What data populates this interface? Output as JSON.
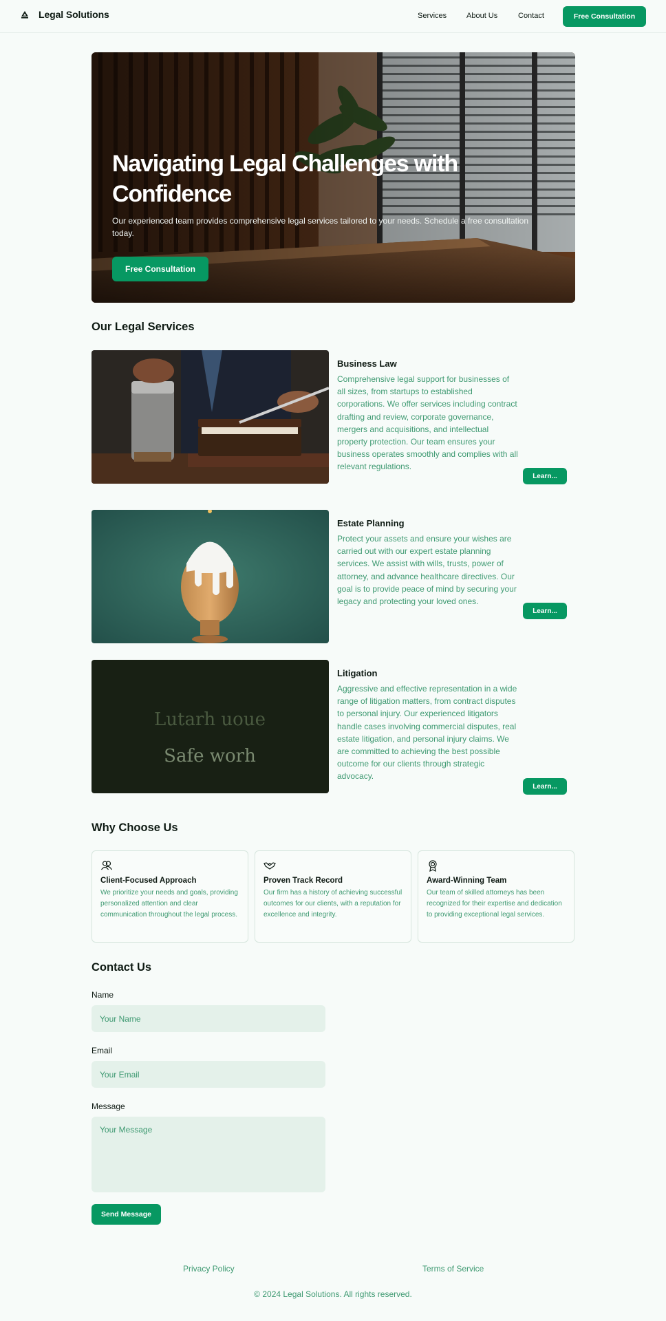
{
  "header": {
    "brand": "Legal Solutions",
    "nav": [
      "Services",
      "About Us",
      "Contact"
    ],
    "cta": "Free Consultation"
  },
  "hero": {
    "title": "Navigating Legal Challenges with Confidence",
    "subtitle": "Our experienced team provides comprehensive legal services tailored to your needs. Schedule a free consultation today.",
    "cta": "Free Consultation"
  },
  "services": {
    "title": "Our Legal Services",
    "items": [
      {
        "name": "Business Law",
        "description": "Comprehensive legal support for businesses of all sizes, from startups to established corporations. We offer services including contract drafting and review, corporate governance, mergers and acquisitions, and intellectual property protection. Our team ensures your business operates smoothly and complies with all relevant regulations.",
        "button": "Learn..."
      },
      {
        "name": "Estate Planning",
        "description": "Protect your assets and ensure your wishes are carried out with our expert estate planning services. We assist with wills, trusts, power of attorney, and advance healthcare directives. Our goal is to provide peace of mind by securing your legacy and protecting your loved ones.",
        "button": "Learn..."
      },
      {
        "name": "Litigation",
        "description": "Aggressive and effective representation in a wide range of litigation matters, from contract disputes to personal injury. Our experienced litigators handle cases involving commercial disputes, real estate litigation, and personal injury claims. We are committed to achieving the best possible outcome for our clients through strategic advocacy.",
        "button": "Learn...",
        "image_text": [
          "Lutarh uoue",
          "Safe worh"
        ]
      }
    ]
  },
  "why": {
    "title": "Why Choose Us",
    "cards": [
      {
        "icon": "users-icon",
        "title": "Client-Focused Approach",
        "description": "We prioritize your needs and goals, providing personalized attention and clear communication throughout the legal process."
      },
      {
        "icon": "handshake-icon",
        "title": "Proven Track Record",
        "description": "Our firm has a history of achieving successful outcomes for our clients, with a reputation for excellence and integrity."
      },
      {
        "icon": "award-icon",
        "title": "Award-Winning Team",
        "description": "Our team of skilled attorneys has been recognized for their expertise and dedication to providing exceptional legal services."
      }
    ]
  },
  "contact": {
    "title": "Contact Us",
    "name_label": "Name",
    "name_placeholder": "Your Name",
    "email_label": "Email",
    "email_placeholder": "Your Email",
    "message_label": "Message",
    "message_placeholder": "Your Message",
    "submit": "Send Message"
  },
  "footer": {
    "privacy": "Privacy Policy",
    "terms": "Terms of Service",
    "copyright": "© 2024 Legal Solutions. All rights reserved."
  },
  "colors": {
    "accent": "#079862",
    "muted_text": "#3f9a72",
    "background": "#f7fbf9",
    "field_bg": "#e4f1ea"
  }
}
